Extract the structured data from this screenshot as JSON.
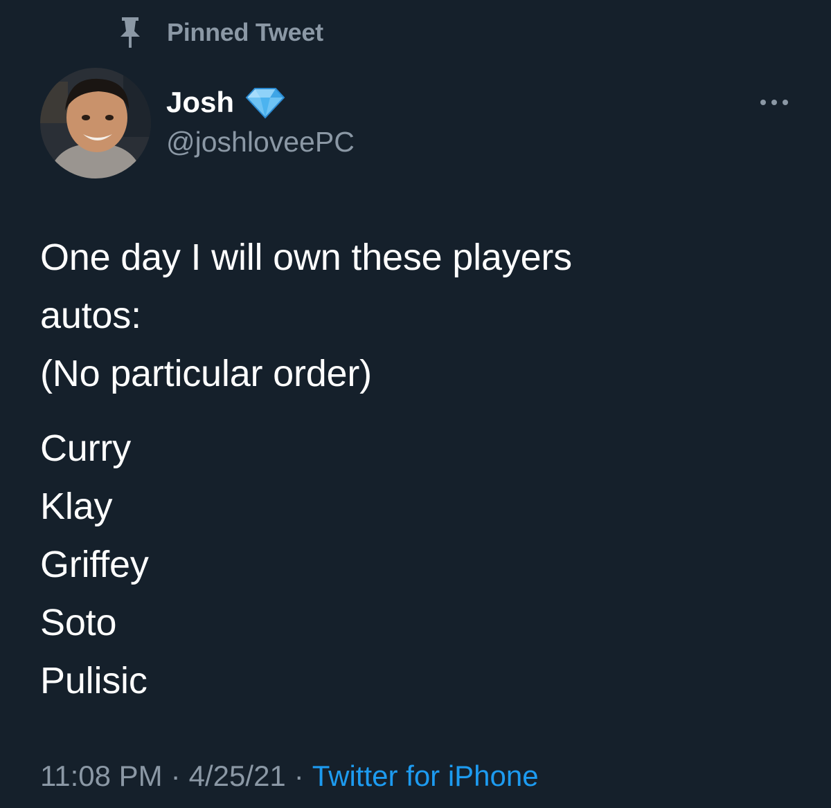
{
  "colors": {
    "background": "#15202b",
    "text_primary": "#ffffff",
    "text_secondary": "#8b98a5",
    "link": "#1d9bf0",
    "verified_diamond": "#6ec3f4"
  },
  "pinned": {
    "icon": "pin-icon",
    "label": "Pinned Tweet"
  },
  "author": {
    "avatar": "avatar",
    "display_name": "Josh",
    "badge_icon": "diamond-icon",
    "handle": "@joshloveePC"
  },
  "more_icon": "more-icon",
  "tweet": {
    "lines": [
      "One day I will own these players",
      "autos:",
      "(No particular order)"
    ],
    "list": [
      "Curry",
      "Klay",
      "Griffey",
      "Soto",
      "Pulisic"
    ]
  },
  "meta": {
    "time": "11:08 PM",
    "separator": "·",
    "date": "4/25/21",
    "source": "Twitter for iPhone"
  }
}
